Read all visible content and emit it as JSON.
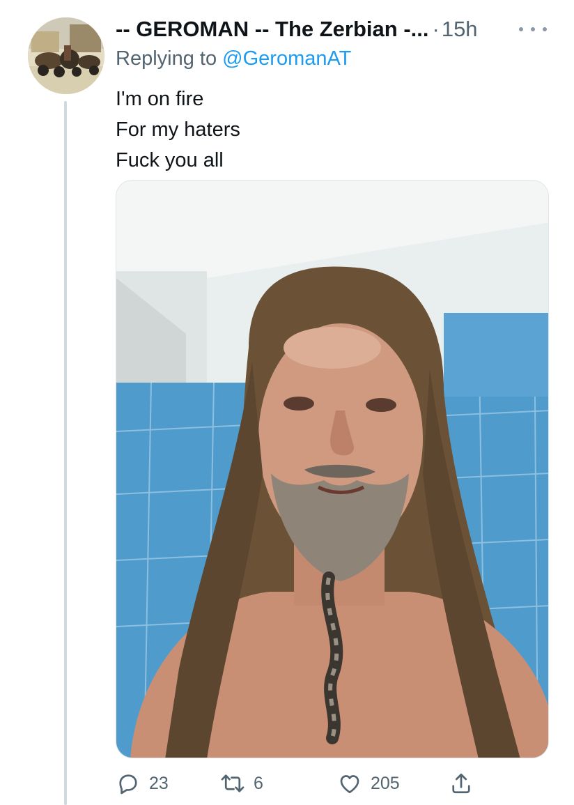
{
  "tweet": {
    "display_name": "-- GEROMAN -- The Zerbian -...",
    "separator": "·",
    "time": "15h",
    "replying_prefix": "Replying to",
    "replying_handle": "@GeromanAT",
    "lines": [
      "I'm on fire",
      "For my haters",
      "Fuck you all"
    ]
  },
  "actions": {
    "reply_count": "23",
    "retweet_count": "6",
    "like_count": "205"
  },
  "icons": {
    "more": "more-horizontal-icon",
    "reply": "speech-bubble-icon",
    "retweet": "retweet-arrows-icon",
    "like": "heart-outline-icon",
    "share": "share-upload-icon"
  },
  "colors": {
    "text": "#0f1419",
    "secondary": "#536471",
    "link": "#1d9bf0",
    "thread_line": "#cfd9de"
  }
}
